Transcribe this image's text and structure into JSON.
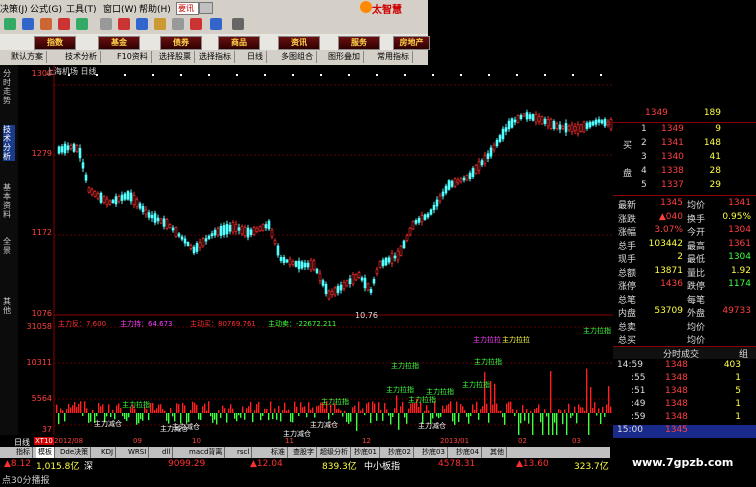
{
  "menu": {
    "items": [
      "决策(J)",
      "公式(G)",
      "工具(T)",
      "窗口(W)",
      "帮助(H)"
    ],
    "search_value": "要讯",
    "brand": "太智慧"
  },
  "categories": [
    "指数",
    "基金",
    "债券",
    "商品",
    "资讯",
    "服务",
    "房地产"
  ],
  "func_buttons": [
    "默认方案",
    "技术分析",
    "F10资料",
    "选择股票",
    "选择指标",
    "日线",
    "多图组合",
    "图形叠加",
    "常用指标"
  ],
  "left_tabs": [
    "分时走势",
    "技术分析",
    "基本资料",
    "全景",
    "其他"
  ],
  "chart": {
    "title": "上海机场 日线",
    "price_axis": [
      "1300",
      "1279",
      "1172",
      "1076"
    ],
    "low_label": "10.76",
    "volume_axis": [
      "31058",
      "10311",
      "5564",
      "37"
    ],
    "indicator_labels": [
      {
        "text": "主力反：7.600",
        "color": "#ff3030"
      },
      {
        "text": "主力持：64.673",
        "color": "#ff40ff"
      },
      {
        "text": "主动买：80769.761",
        "color": "#ff3030"
      },
      {
        "text": "主动卖：-22672.211",
        "color": "#40ff40"
      }
    ],
    "annotations": [
      {
        "text": "主力拉拉",
        "color": "#ff40ff"
      },
      {
        "text": "主力拉拉",
        "color": "#ffff40"
      },
      {
        "text": "主力拉指",
        "color": "#40ff40"
      },
      {
        "text": "主力拉指",
        "color": "#40ff40"
      },
      {
        "text": "主力拉指",
        "color": "#40ff40"
      },
      {
        "text": "主力拉指",
        "color": "#40ff40"
      },
      {
        "text": "主力拉指",
        "color": "#40ff40"
      },
      {
        "text": "主力拉指",
        "color": "#40ff40"
      },
      {
        "text": "主力拉指",
        "color": "#40ff40"
      },
      {
        "text": "主力拉指",
        "color": "#40ff40"
      },
      {
        "text": "主力拉指",
        "color": "#40ff40"
      },
      {
        "text": "主力减仓",
        "color": "#ffffff"
      },
      {
        "text": "主力减仓",
        "color": "#ffffff"
      },
      {
        "text": "主力减仓",
        "color": "#ffffff"
      },
      {
        "text": "主力减仓",
        "color": "#ffffff"
      },
      {
        "text": "主力减仓",
        "color": "#ffffff"
      },
      {
        "text": "主力减仓",
        "color": "#ffffff"
      }
    ],
    "date_labels": [
      "2012/08",
      "09",
      "10",
      "11",
      "12",
      "2013/01",
      "02",
      "03"
    ],
    "left_date_tag": "XT10"
  },
  "quote_panel": {
    "orders_top": [
      [
        "",
        "1349",
        "189"
      ],
      [
        "",
        "1",
        "1349",
        "9"
      ]
    ],
    "buy_label": "买",
    "sell_label": "盘",
    "orders": [
      {
        "side": "",
        "level": "",
        "price": "1349",
        "vol": "189"
      },
      {
        "side": "买",
        "level": "1",
        "price": "1349",
        "vol": "9"
      },
      {
        "side": "",
        "level": "2",
        "price": "1341",
        "vol": "148"
      },
      {
        "side": "",
        "level": "3",
        "price": "1340",
        "vol": "41"
      },
      {
        "side": "盘",
        "level": "4",
        "price": "1338",
        "vol": "28"
      },
      {
        "side": "",
        "level": "5",
        "price": "1337",
        "vol": "29"
      }
    ],
    "stats": [
      {
        "l1": "最新",
        "v1": "1345",
        "l2": "均价",
        "v2": "1341"
      },
      {
        "l1": "涨跌",
        "v1": "▲040",
        "l2": "换手",
        "v2": "0.95%"
      },
      {
        "l1": "涨幅",
        "v1": "3.07%",
        "l2": "今开",
        "v2": "1304"
      },
      {
        "l1": "总手",
        "v1": "103442",
        "l2": "最高",
        "v2": "1361"
      },
      {
        "l1": "现手",
        "v1": "2",
        "l2": "最低",
        "v2": "1304"
      },
      {
        "l1": "总额",
        "v1": "13871",
        "l2": "量比",
        "v2": "1.92"
      },
      {
        "l1": "涨停",
        "v1": "1436",
        "l2": "跌停",
        "v2": "1174"
      },
      {
        "l1": "总笔",
        "v1": "",
        "l2": "每笔",
        "v2": ""
      },
      {
        "l1": "内盘",
        "v1": "53709",
        "l2": "外盘",
        "v2": "49733"
      },
      {
        "l1": "总卖",
        "v1": "",
        "l2": "均价",
        "v2": ""
      },
      {
        "l1": "总买",
        "v1": "",
        "l2": "均价",
        "v2": ""
      }
    ],
    "tick_header": "分时成交",
    "tick_header_right": "组",
    "ticks": [
      {
        "t": "14:59",
        "p": "1348",
        "v": "403"
      },
      {
        "t": ":55",
        "p": "1348",
        "v": "1"
      },
      {
        "t": ":51",
        "p": "1348",
        "v": "5"
      },
      {
        "t": ":49",
        "p": "1348",
        "v": "1"
      },
      {
        "t": ":59",
        "p": "1348",
        "v": "1"
      },
      {
        "t": "15:00",
        "p": "1345",
        "v": ""
      }
    ]
  },
  "bottom_tabs": [
    "指标",
    "模板",
    "Dde决策",
    "KDJ",
    "WRSI",
    "dll",
    "macd背离",
    "rscl",
    "标准",
    "查股字",
    "超级分析",
    "抄底01",
    "抄底02",
    "抄底03",
    "抄底04",
    "其他"
  ],
  "period_tab": "日线",
  "ticker": [
    {
      "text": "▲8.12",
      "color": "#ff3030"
    },
    {
      "text": "1,015.8亿",
      "color": "#ffff40"
    },
    {
      "text": "深",
      "color": "#ffffff"
    },
    {
      "text": "9099.29",
      "color": "#ff3030"
    },
    {
      "text": "▲12.04",
      "color": "#ff3030"
    },
    {
      "text": "839.3亿",
      "color": "#ffff40"
    },
    {
      "text": "中小板指",
      "color": "#ffffff"
    },
    {
      "text": "4578.31",
      "color": "#ff3030"
    },
    {
      "text": "▲13.60",
      "color": "#ff3030"
    },
    {
      "text": "323.7亿",
      "color": "#ffff40"
    }
  ],
  "status_text": "点30分播报",
  "watermark": "www.7gpzb.com"
}
